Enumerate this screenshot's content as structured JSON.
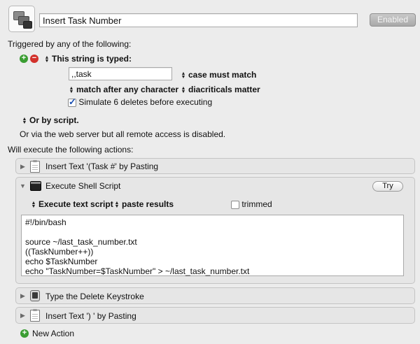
{
  "macro": {
    "name": "Insert Task Number",
    "enabled_label": "Enabled"
  },
  "trigger": {
    "heading": "Triggered by any of the following:",
    "string_trigger_label": "This string is typed:",
    "typed_string": ",,task",
    "case_option": "case must match",
    "match_option": "match after any character",
    "diacriticals_option": "diacriticals matter",
    "simulate_label": "Simulate 6 deletes before executing",
    "simulate_checked": true,
    "script_trigger_label": "Or by script.",
    "web_server_note": "Or via the web server but all remote access is disabled."
  },
  "actions_heading": "Will execute the following actions:",
  "actions": [
    {
      "title": "Insert Text '(Task #' by Pasting",
      "icon": "clipboard-icon",
      "expanded": false
    },
    {
      "title": "Execute Shell Script",
      "icon": "terminal-icon",
      "expanded": true,
      "try_label": "Try",
      "execute_option": "Execute text script",
      "result_option": "paste results",
      "trimmed_label": "trimmed",
      "trimmed_checked": false,
      "script_lines": [
        "#!/bin/bash",
        "",
        "source ~/last_task_number.txt",
        "((TaskNumber++))",
        "echo $TaskNumber",
        "echo \"TaskNumber=$TaskNumber\" > ~/last_task_number.txt"
      ]
    },
    {
      "title": "Type the Delete Keystroke",
      "icon": "keyboard-key-icon",
      "expanded": false
    },
    {
      "title": "Insert Text ') ' by Pasting",
      "icon": "clipboard-icon",
      "expanded": false
    }
  ],
  "new_action_label": "New Action",
  "colors": {
    "add": "#3a9d32",
    "remove": "#d2312b"
  }
}
